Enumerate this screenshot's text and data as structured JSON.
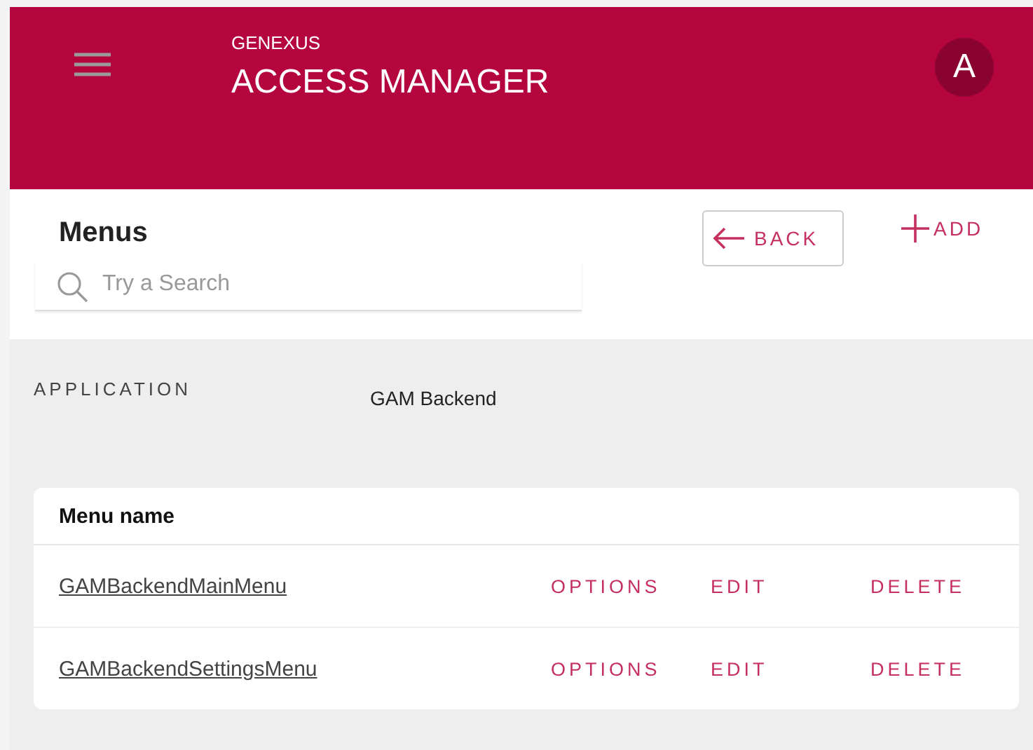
{
  "header": {
    "brand": "GENEXUS",
    "title": "ACCESS MANAGER",
    "avatar": "A"
  },
  "toolbar": {
    "title": "Menus",
    "search": {
      "placeholder": "Try a Search"
    },
    "back": "BACK",
    "add": "ADD"
  },
  "application": {
    "label": "APPLICATION",
    "value": "GAM Backend"
  },
  "table": {
    "columns": [
      "Menu name"
    ],
    "rows": [
      {
        "name": "GAMBackendMainMenu",
        "actions": [
          "OPTIONS",
          "EDIT",
          "DELETE"
        ]
      },
      {
        "name": "GAMBackendSettingsMenu",
        "actions": [
          "OPTIONS",
          "EDIT",
          "DELETE"
        ]
      }
    ]
  }
}
